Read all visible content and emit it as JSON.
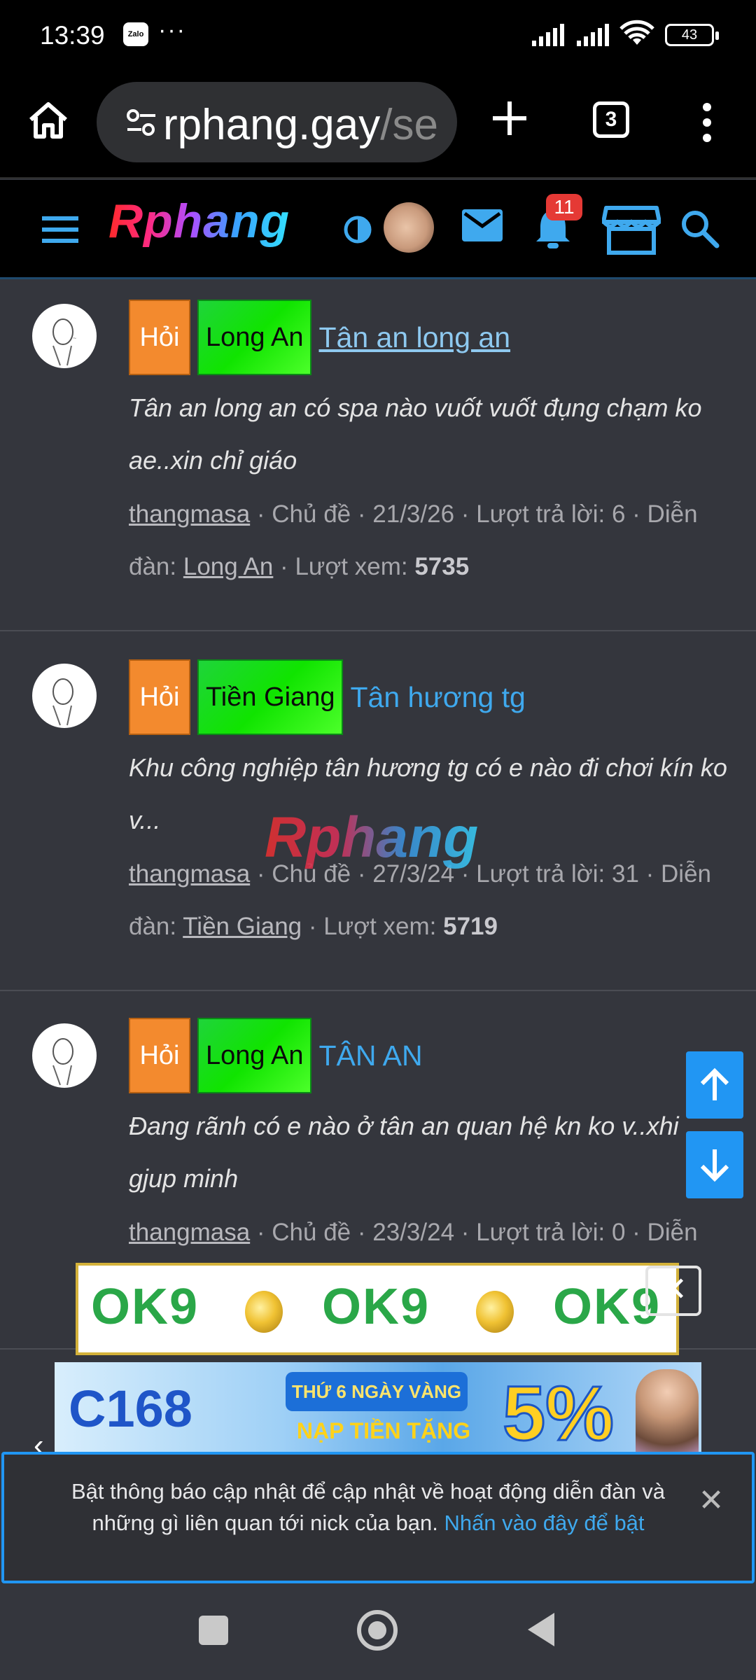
{
  "status_bar": {
    "time": "13:39",
    "app_icon": "Zalo",
    "more": "···",
    "battery": "43"
  },
  "browser": {
    "url_main": "rphang.gay",
    "url_faded": "/se",
    "tab_count": "3"
  },
  "site": {
    "logo": "Rphang",
    "notification_count": "11"
  },
  "threads": [
    {
      "prefix": "Hỏi",
      "forum_tag": "Long An",
      "title": "Tân an long an",
      "snippet": "Tân an long an có spa nào vuốt vuốt đụng chạm ko ae..xin chỉ giáo",
      "author": "thangmasa",
      "type": "Chủ đề",
      "date": "21/3/26",
      "replies_label": "Lượt trả lời: 6",
      "forum_label": "Diễn đàn:",
      "forum": "Long An",
      "views_label": "Lượt xem:",
      "views": "5735"
    },
    {
      "prefix": "Hỏi",
      "forum_tag": "Tiền Giang",
      "title": "Tân hương tg",
      "snippet": "Khu công nghiệp tân hương tg có e nào đi chơi kín ko v...",
      "author": "thangmasa",
      "type": "Chủ đề",
      "date": "27/3/24",
      "replies_label": "Lượt trả lời: 31",
      "forum_label": "Diễn đàn:",
      "forum": "Tiền Giang",
      "views_label": "Lượt xem:",
      "views": "5719"
    },
    {
      "prefix": "Hỏi",
      "forum_tag": "Long An",
      "title": "TÂN AN",
      "snippet": "Đang rãnh có e nào ở tân an quan hệ kn ko v..xhi gjup minh",
      "author": "thangmasa",
      "type": "Chủ đề",
      "date": "23/3/24",
      "replies_label": "Lượt trả lời: 0",
      "forum_label": "Diễn"
    }
  ],
  "watermark": "Rphang",
  "ads": {
    "ok9": [
      "OK9",
      "OK9",
      "OK9"
    ],
    "c168_logo": "C168",
    "c168_line1": "THỨ 6 NGÀY VÀNG",
    "c168_line2": "NẠP TIỀN TẶNG",
    "c168_percent": "5%"
  },
  "notification": {
    "text": "Bật thông báo cập nhật để cập nhật về hoạt động diễn đàn và những gì liên quan tới nick của bạn.",
    "link": "Nhấn vào đây để bật"
  },
  "colors": {
    "accent": "#2196f3",
    "link": "#3fa9ee",
    "tag_hoi": "#f38a2e",
    "tag_region": "#10e400",
    "badge": "#e53935"
  }
}
